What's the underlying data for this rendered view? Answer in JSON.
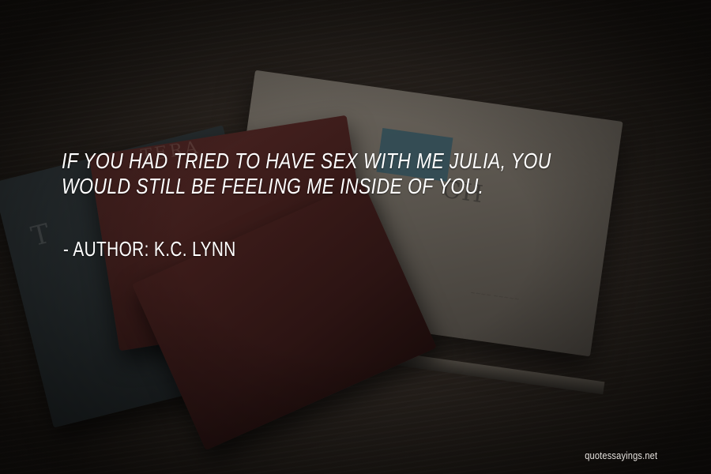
{
  "quote": {
    "text": "If you had tried to have sex with me Julia, you would still be feeling me inside of you.",
    "author_line": "- Author: K.C. Lynn"
  },
  "watermark": {
    "text": "quotessayings.net"
  },
  "colors": {
    "text": "#ffffff",
    "background": "#2a241f",
    "red_book": "#3a1b19",
    "white_book": "#58534c",
    "dark_book": "#22282a"
  }
}
